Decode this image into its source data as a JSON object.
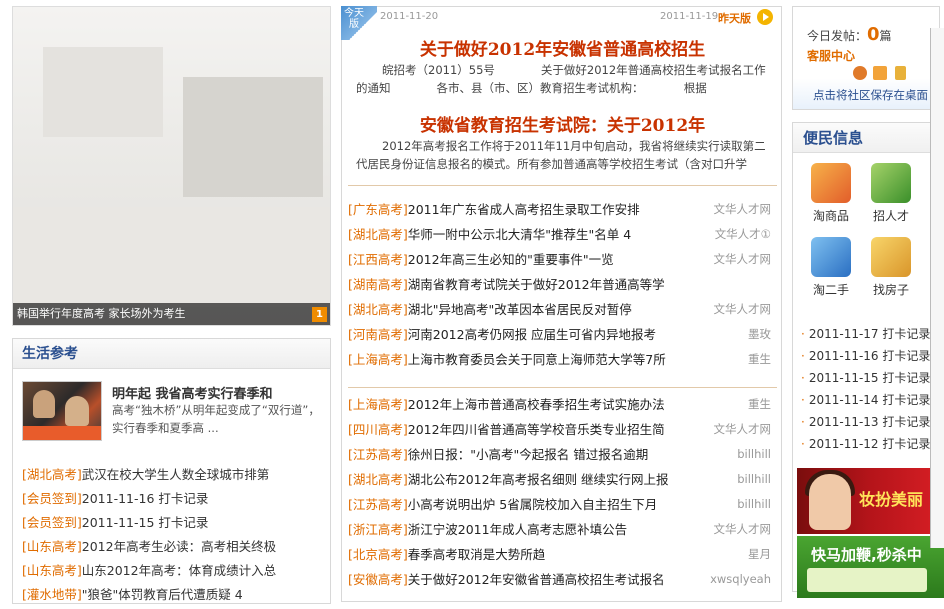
{
  "hero": {
    "caption": "韩国举行年度高考 家长场外为考生",
    "index": "1"
  },
  "life": {
    "title": "生活参考",
    "feature": {
      "title": "明年起 我省高考实行春季和",
      "desc": "高考“独木桥”从明年起变成了“双行道”，实行春季和夏季高 ..."
    },
    "items": [
      {
        "tag": "[湖北高考]",
        "text": "武汉在校大学生人数全球城市排第"
      },
      {
        "tag": "[会员签到]",
        "text": "2011-11-16 打卡记录"
      },
      {
        "tag": "[会员签到]",
        "text": "2011-11-15 打卡记录"
      },
      {
        "tag": "[山东高考]",
        "text": "2012年高考生必读：高考相关终极"
      },
      {
        "tag": "[山东高考]",
        "text": "山东2012年高考：体育成绩计入总"
      },
      {
        "tag": "[灌水地带]",
        "text": "\"狼爸\"体罚教育后代遭质疑 4"
      }
    ]
  },
  "mid": {
    "badge": "今天版",
    "date_left": "2011-11-20",
    "date_right": "2011-11-19",
    "yesterday": "昨天版",
    "headline1": "关于做好2012年安徽省普通高校招生",
    "summary1": "皖招考（2011）55号　　　　关于做好2012年普通高校招生考试报名工作的通知　　　　各市、县（市、区）教育招生考试机构：　　　　根据",
    "headline2": "安徽省教育招生考试院：关于2012年",
    "summary2": "2012年高考报名工作将于2011年11月中旬启动，我省将继续实行读取第二代居民身份证信息报名的模式。所有参加普通高等学校招生考试（含对口升学",
    "news1": [
      {
        "tag": "[广东高考]",
        "title": "2011年广东省成人高考招生录取工作安排",
        "src": "文华人才网"
      },
      {
        "tag": "[湖北高考]",
        "title": "华师一附中公示北大清华\"推荐生\"名单 4",
        "src": "文华人才①"
      },
      {
        "tag": "[江西高考]",
        "title": "2012年高三生必知的\"重要事件\"一览",
        "src": "文华人才网"
      },
      {
        "tag": "[湖南高考]",
        "title": "湖南省教育考试院关于做好2012年普通高等学",
        "src": ""
      },
      {
        "tag": "[湖北高考]",
        "title": "湖北\"异地高考\"改革因本省居民反对暂停",
        "src": "文华人才网"
      },
      {
        "tag": "[河南高考]",
        "title": "河南2012高考仍网报 应届生可省内异地报考",
        "src": "墨玫"
      },
      {
        "tag": "[上海高考]",
        "title": "上海市教育委员会关于同意上海师范大学等7所",
        "src": "重生"
      }
    ],
    "news2": [
      {
        "tag": "[上海高考]",
        "title": "2012年上海市普通高校春季招生考试实施办法",
        "src": "重生"
      },
      {
        "tag": "[四川高考]",
        "title": "2012年四川省普通高等学校音乐类专业招生简",
        "src": "文华人才网"
      },
      {
        "tag": "[江苏高考]",
        "title": "徐州日报：\"小高考\"今起报名 错过报名逾期",
        "src": "billhill"
      },
      {
        "tag": "[湖北高考]",
        "title": "湖北公布2012年高考报名细则 继续实行网上报",
        "src": "billhill"
      },
      {
        "tag": "[江苏高考]",
        "title": "小高考说明出炉 5省属院校加入自主招生下月",
        "src": "billhill"
      },
      {
        "tag": "[浙江高考]",
        "title": "浙江宁波2011年成人高考志愿补填公告",
        "src": "文华人才网"
      },
      {
        "tag": "[北京高考]",
        "title": "春季高考取消是大势所趋",
        "src": "星月"
      },
      {
        "tag": "[安徽高考]",
        "title": "关于做好2012年安徽省普通高校招生考试报名",
        "src": "xwsqlyeah"
      }
    ]
  },
  "right": {
    "today_label": "今日发帖：",
    "today_count": "0",
    "today_unit": "篇",
    "service": "客服中心",
    "save_desktop": "点击将社区保存在桌面",
    "conv_title": "便民信息",
    "services": [
      {
        "label": "淘商品",
        "color": "#e98a2a"
      },
      {
        "label": "招人才",
        "color": "#57a63b"
      },
      {
        "label": "淘二手",
        "color": "#3c8bd6"
      },
      {
        "label": "找房子",
        "color": "#e9b22a"
      }
    ],
    "checkins": [
      "2011-11-17 打卡记录",
      "2011-11-16 打卡记录",
      "2011-11-15 打卡记录",
      "2011-11-14 打卡记录",
      "2011-11-13 打卡记录",
      "2011-11-12 打卡记录"
    ],
    "ad1_text": "妆扮美丽",
    "ad2_text": "快马加鞭,秒杀中"
  }
}
